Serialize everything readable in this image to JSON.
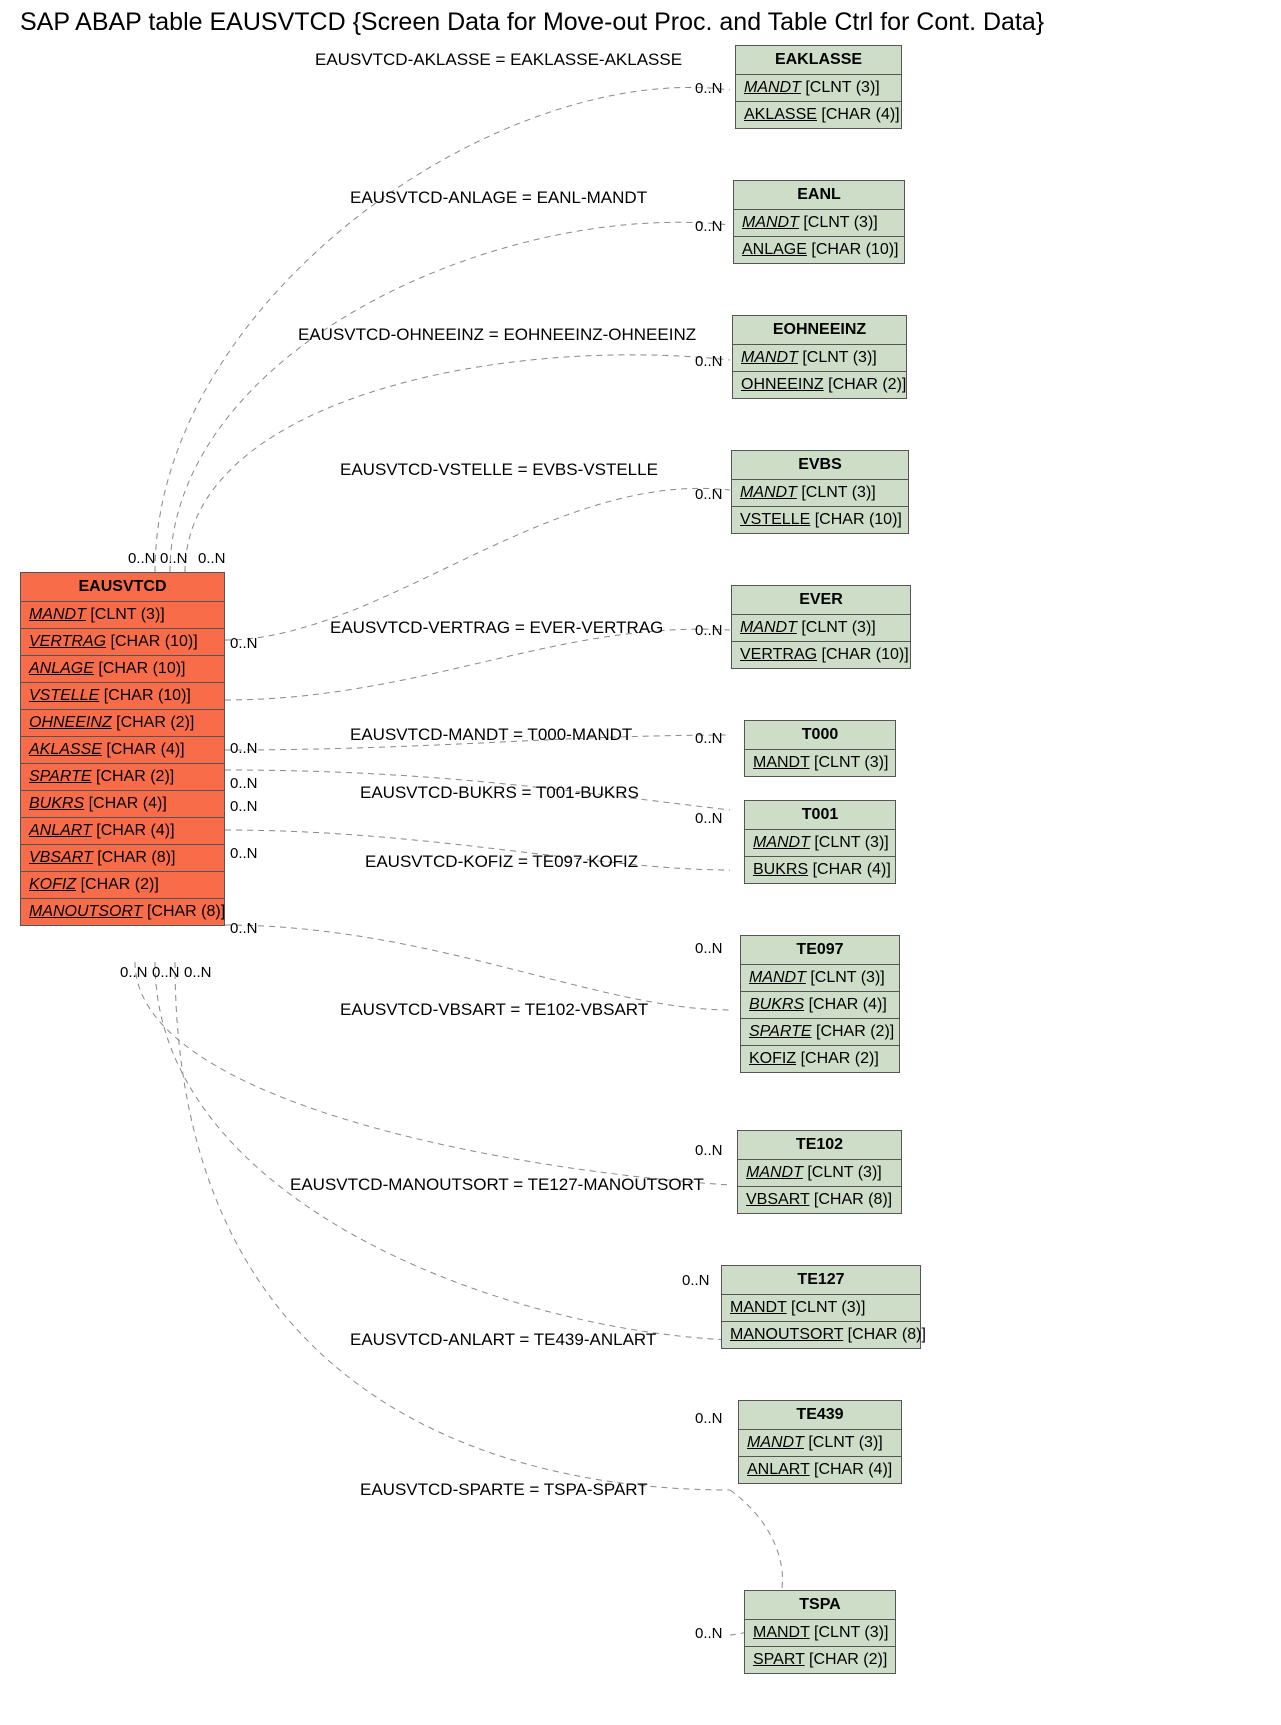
{
  "title": "SAP ABAP table EAUSVTCD {Screen Data for Move-out Proc. and Table Ctrl for Cont. Data}",
  "main_entity": {
    "name": "EAUSVTCD",
    "fields": [
      {
        "name": "MANDT",
        "type": "[CLNT (3)]",
        "italic": true
      },
      {
        "name": "VERTRAG",
        "type": "[CHAR (10)]",
        "italic": true
      },
      {
        "name": "ANLAGE",
        "type": "[CHAR (10)]",
        "italic": true
      },
      {
        "name": "VSTELLE",
        "type": "[CHAR (10)]",
        "italic": true
      },
      {
        "name": "OHNEEINZ",
        "type": "[CHAR (2)]",
        "italic": true
      },
      {
        "name": "AKLASSE",
        "type": "[CHAR (4)]",
        "italic": true
      },
      {
        "name": "SPARTE",
        "type": "[CHAR (2)]",
        "italic": true
      },
      {
        "name": "BUKRS",
        "type": "[CHAR (4)]",
        "italic": true
      },
      {
        "name": "ANLART",
        "type": "[CHAR (4)]",
        "italic": true
      },
      {
        "name": "VBSART",
        "type": "[CHAR (8)]",
        "italic": true
      },
      {
        "name": "KOFIZ",
        "type": "[CHAR (2)]",
        "italic": true
      },
      {
        "name": "MANOUTSORT",
        "type": "[CHAR (8)]",
        "italic": true
      }
    ]
  },
  "related": [
    {
      "name": "EAKLASSE",
      "fields": [
        {
          "name": "MANDT",
          "type": "[CLNT (3)]",
          "italic": true
        },
        {
          "name": "AKLASSE",
          "type": "[CHAR (4)]",
          "italic": false
        }
      ]
    },
    {
      "name": "EANL",
      "fields": [
        {
          "name": "MANDT",
          "type": "[CLNT (3)]",
          "italic": true
        },
        {
          "name": "ANLAGE",
          "type": "[CHAR (10)]",
          "italic": false
        }
      ]
    },
    {
      "name": "EOHNEEINZ",
      "fields": [
        {
          "name": "MANDT",
          "type": "[CLNT (3)]",
          "italic": true
        },
        {
          "name": "OHNEEINZ",
          "type": "[CHAR (2)]",
          "italic": false
        }
      ]
    },
    {
      "name": "EVBS",
      "fields": [
        {
          "name": "MANDT",
          "type": "[CLNT (3)]",
          "italic": true
        },
        {
          "name": "VSTELLE",
          "type": "[CHAR (10)]",
          "italic": false
        }
      ]
    },
    {
      "name": "EVER",
      "fields": [
        {
          "name": "MANDT",
          "type": "[CLNT (3)]",
          "italic": true
        },
        {
          "name": "VERTRAG",
          "type": "[CHAR (10)]",
          "italic": false
        }
      ]
    },
    {
      "name": "T000",
      "fields": [
        {
          "name": "MANDT",
          "type": "[CLNT (3)]",
          "italic": false
        }
      ]
    },
    {
      "name": "T001",
      "fields": [
        {
          "name": "MANDT",
          "type": "[CLNT (3)]",
          "italic": true
        },
        {
          "name": "BUKRS",
          "type": "[CHAR (4)]",
          "italic": false
        }
      ]
    },
    {
      "name": "TE097",
      "fields": [
        {
          "name": "MANDT",
          "type": "[CLNT (3)]",
          "italic": true
        },
        {
          "name": "BUKRS",
          "type": "[CHAR (4)]",
          "italic": true
        },
        {
          "name": "SPARTE",
          "type": "[CHAR (2)]",
          "italic": true
        },
        {
          "name": "KOFIZ",
          "type": "[CHAR (2)]",
          "italic": false
        }
      ]
    },
    {
      "name": "TE102",
      "fields": [
        {
          "name": "MANDT",
          "type": "[CLNT (3)]",
          "italic": true
        },
        {
          "name": "VBSART",
          "type": "[CHAR (8)]",
          "italic": false
        }
      ]
    },
    {
      "name": "TE127",
      "fields": [
        {
          "name": "MANDT",
          "type": "[CLNT (3)]",
          "italic": false
        },
        {
          "name": "MANOUTSORT",
          "type": "[CHAR (8)]",
          "italic": false
        }
      ]
    },
    {
      "name": "TE439",
      "fields": [
        {
          "name": "MANDT",
          "type": "[CLNT (3)]",
          "italic": true
        },
        {
          "name": "ANLART",
          "type": "[CHAR (4)]",
          "italic": false
        }
      ]
    },
    {
      "name": "TSPA",
      "fields": [
        {
          "name": "MANDT",
          "type": "[CLNT (3)]",
          "italic": false
        },
        {
          "name": "SPART",
          "type": "[CHAR (2)]",
          "italic": false
        }
      ]
    }
  ],
  "relations": [
    {
      "label": "EAUSVTCD-AKLASSE = EAKLASSE-AKLASSE",
      "left": "0..N",
      "right": "0..N"
    },
    {
      "label": "EAUSVTCD-ANLAGE = EANL-MANDT",
      "left": "0..N",
      "right": "0..N"
    },
    {
      "label": "EAUSVTCD-OHNEEINZ = EOHNEEINZ-OHNEEINZ",
      "left": "0..N",
      "right": "0..N"
    },
    {
      "label": "EAUSVTCD-VSTELLE = EVBS-VSTELLE",
      "left": "0..N",
      "right": "0..N"
    },
    {
      "label": "EAUSVTCD-VERTRAG = EVER-VERTRAG",
      "left": "0..N",
      "right": "0..N"
    },
    {
      "label": "EAUSVTCD-MANDT = T000-MANDT",
      "left": "0..N",
      "right": "0..N"
    },
    {
      "label": "EAUSVTCD-BUKRS = T001-BUKRS",
      "left": "0..N",
      "right": "0..N"
    },
    {
      "label": "EAUSVTCD-KOFIZ = TE097-KOFIZ",
      "left": "0..N",
      "right": "0..N"
    },
    {
      "label": "EAUSVTCD-VBSART = TE102-VBSART",
      "left": "0..N",
      "right": "0..N"
    },
    {
      "label": "EAUSVTCD-MANOUTSORT = TE127-MANOUTSORT",
      "left": "0..N",
      "right": "0..N"
    },
    {
      "label": "EAUSVTCD-ANLART = TE439-ANLART",
      "left": "0..N",
      "right": "0..N"
    },
    {
      "label": "EAUSVTCD-SPARTE = TSPA-SPART",
      "left": "0..N",
      "right": "0..N"
    }
  ],
  "extra_cards": {
    "top": [
      "0..N",
      "0..N",
      "0..N"
    ],
    "bottom": [
      "0..N",
      "0..N",
      "0..N"
    ]
  }
}
